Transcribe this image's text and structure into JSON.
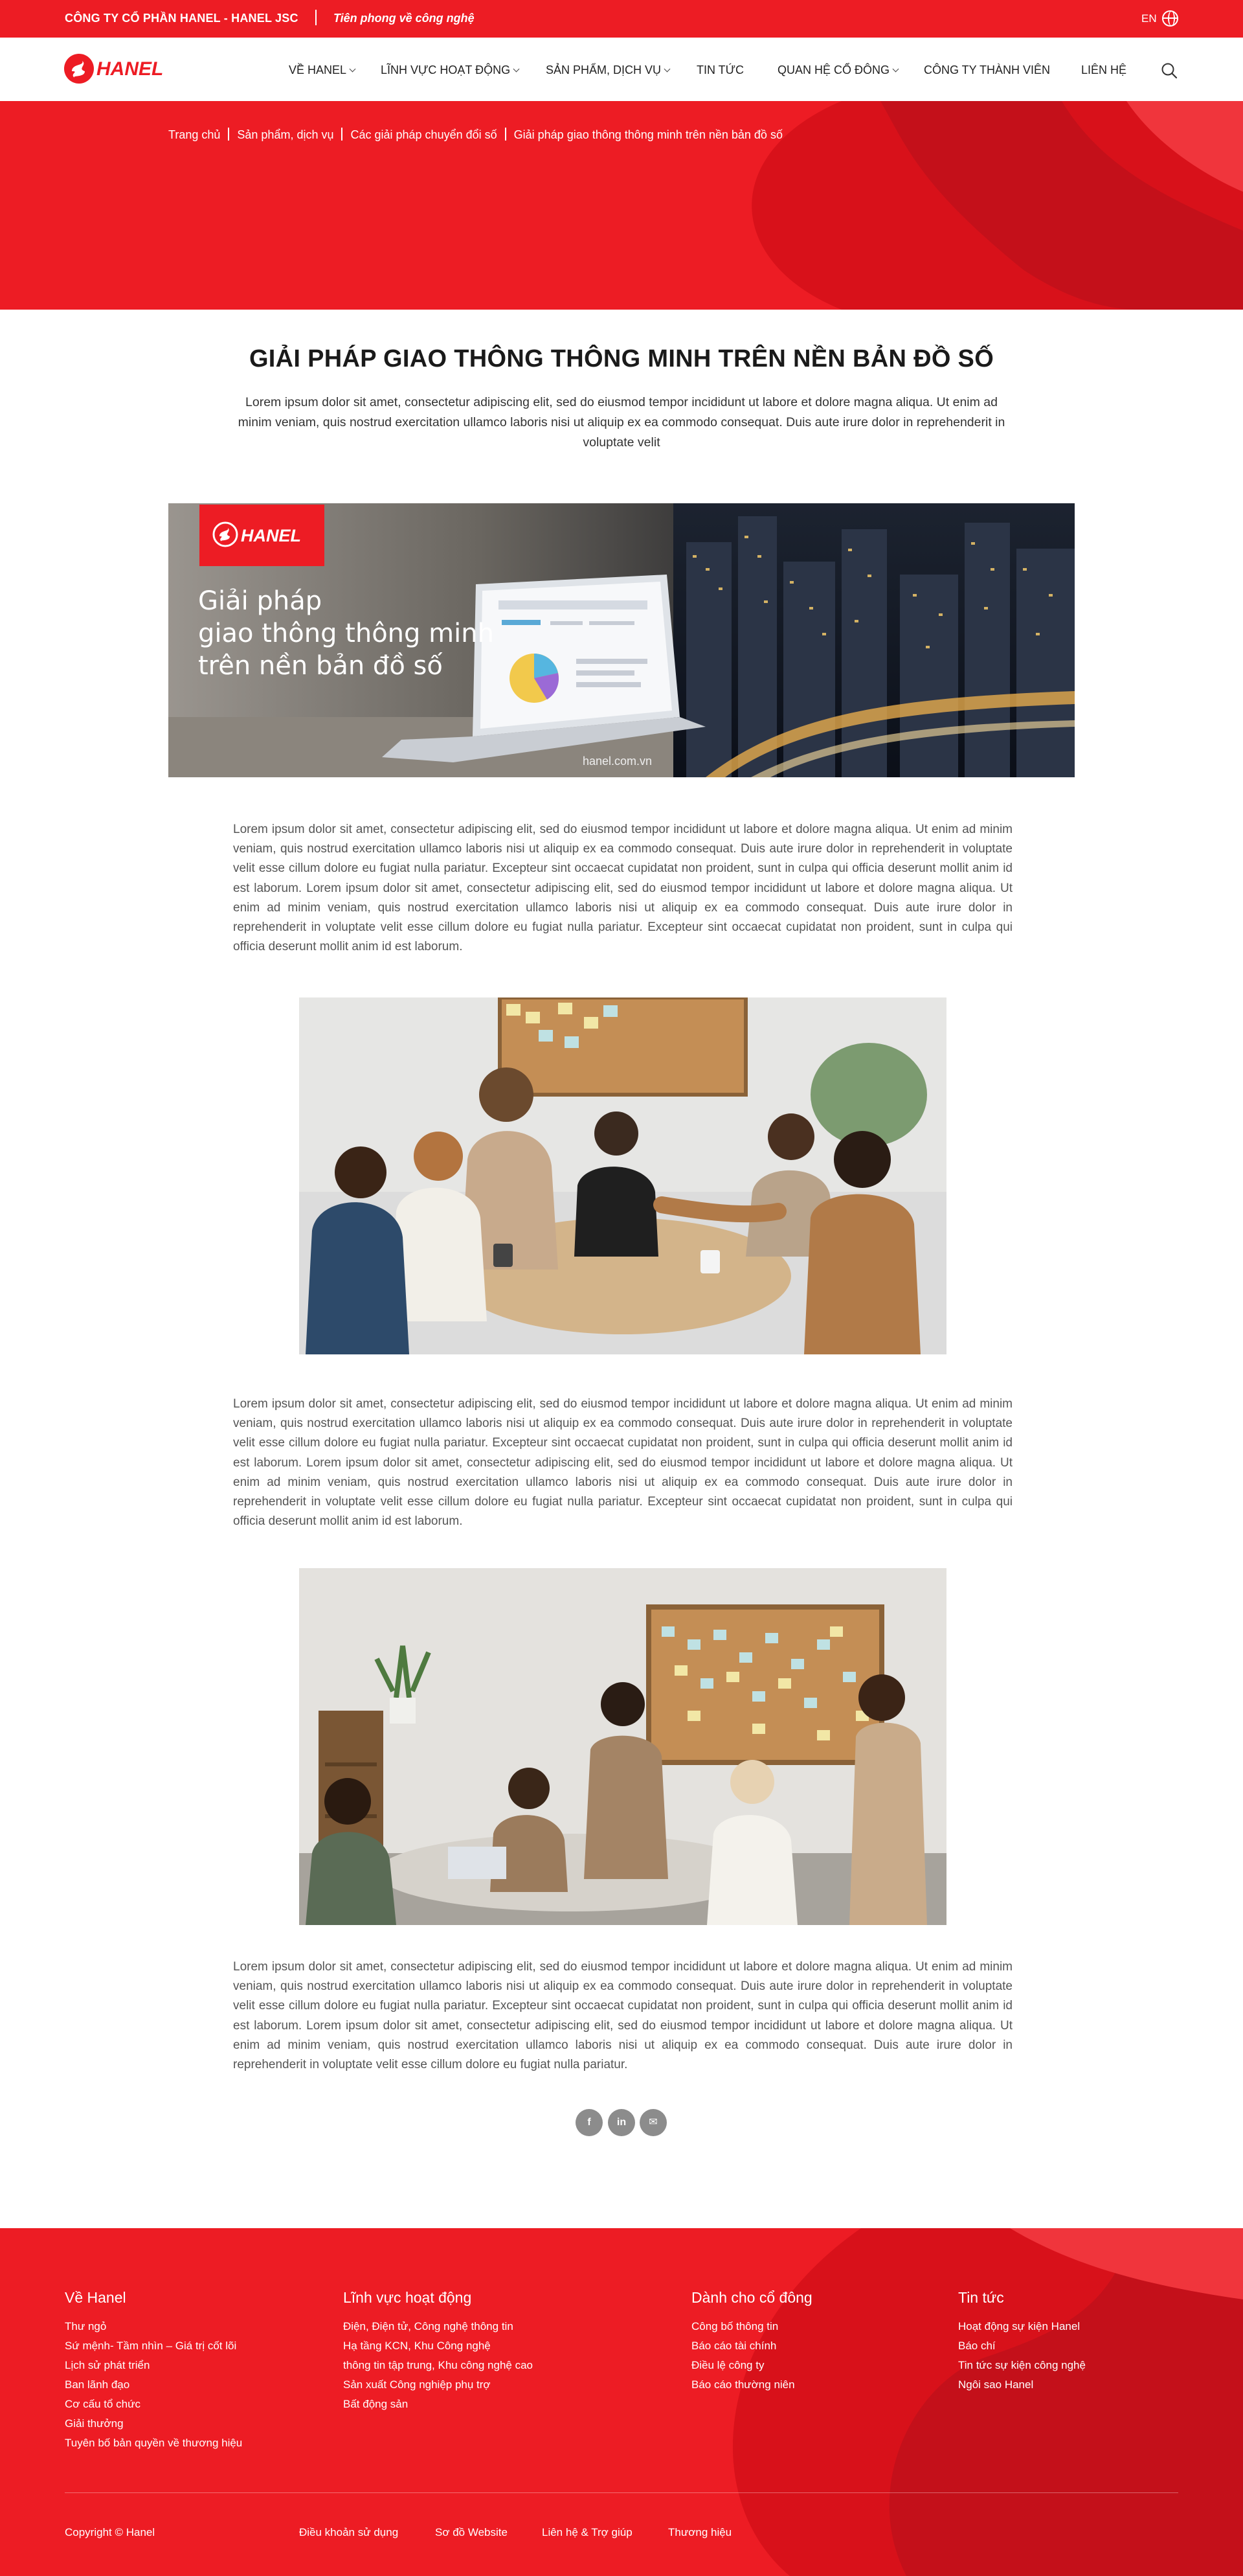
{
  "topbar": {
    "company": "CÔNG TY CỔ PHẦN HANEL - HANEL JSC",
    "slogan": "Tiên phong về công nghệ",
    "lang": "EN"
  },
  "brand": {
    "logo_text": "HANEL",
    "primary_color": "#ed1c24",
    "dark_red": "#d0121a"
  },
  "nav": {
    "items": [
      {
        "label": "VỀ HANEL",
        "has_dropdown": true
      },
      {
        "label": "LĨNH VỰC HOẠT ĐỘNG",
        "has_dropdown": true
      },
      {
        "label": "SẢN PHẨM, DỊCH VỤ",
        "has_dropdown": true
      },
      {
        "label": "TIN TỨC",
        "has_dropdown": false
      },
      {
        "label": "QUAN HỆ CỔ ĐÔNG",
        "has_dropdown": true
      },
      {
        "label": "CÔNG TY THÀNH VIÊN",
        "has_dropdown": false
      },
      {
        "label": "LIÊN HỆ",
        "has_dropdown": false
      }
    ],
    "search_icon": "search-icon"
  },
  "breadcrumb": [
    "Trang chủ",
    "Sản phẩm, dịch vụ",
    "Các giải pháp chuyển đổi số",
    "Giải pháp giao thông thông minh trên nền bản đồ số"
  ],
  "article": {
    "title": "GIẢI PHÁP GIAO THÔNG THÔNG MINH TRÊN NỀN BẢN ĐỒ SỐ",
    "intro": "Lorem ipsum dolor sit amet, consectetur adipiscing elit, sed do eiusmod tempor incididunt ut labore et dolore magna aliqua. Ut enim ad minim veniam, quis nostrud exercitation ullamco laboris nisi ut aliquip ex ea commodo consequat. Duis aute irure dolor in reprehenderit in voluptate velit",
    "banner": {
      "line1": "Giải pháp",
      "line2": "giao thông thông minh",
      "line3": "trên nền bản đồ số",
      "url": "hanel.com.vn"
    },
    "paragraphs": [
      "Lorem ipsum dolor sit amet, consectetur adipiscing elit, sed do eiusmod tempor incididunt ut labore et dolore magna aliqua. Ut enim ad minim veniam, quis nostrud exercitation ullamco laboris nisi ut aliquip ex ea commodo consequat. Duis aute irure dolor in reprehenderit in voluptate velit esse cillum dolore eu fugiat nulla pariatur. Excepteur sint occaecat cupidatat non proident, sunt in culpa qui officia deserunt mollit anim id est laborum. Lorem ipsum dolor sit amet, consectetur adipiscing elit, sed do eiusmod tempor incididunt ut labore et dolore magna aliqua. Ut enim ad minim veniam, quis nostrud exercitation ullamco laboris nisi ut aliquip ex ea commodo consequat. Duis aute irure dolor in reprehenderit in voluptate velit esse cillum dolore eu fugiat nulla pariatur. Excepteur sint occaecat cupidatat non proident, sunt in culpa qui officia deserunt mollit anim id est laborum.",
      "Lorem ipsum dolor sit amet, consectetur adipiscing elit, sed do eiusmod tempor incididunt ut labore et dolore magna aliqua. Ut enim ad minim veniam, quis nostrud exercitation ullamco laboris nisi ut aliquip ex ea commodo consequat. Duis aute irure dolor in reprehenderit in voluptate velit esse cillum dolore eu fugiat nulla pariatur. Excepteur sint occaecat cupidatat non proident, sunt in culpa qui officia deserunt mollit anim id est laborum. Lorem ipsum dolor sit amet, consectetur adipiscing elit, sed do eiusmod tempor incididunt ut labore et dolore magna aliqua. Ut enim ad minim veniam, quis nostrud exercitation ullamco laboris nisi ut aliquip ex ea commodo consequat. Duis aute irure dolor in reprehenderit in voluptate velit esse cillum dolore eu fugiat nulla pariatur. Excepteur sint occaecat cupidatat non proident, sunt in culpa qui officia deserunt mollit anim id est laborum.",
      "Lorem ipsum dolor sit amet, consectetur adipiscing elit, sed do eiusmod tempor incididunt ut labore et dolore magna aliqua. Ut enim ad minim veniam, quis nostrud exercitation ullamco laboris nisi ut aliquip ex ea commodo consequat. Duis aute irure dolor in reprehenderit in voluptate velit esse cillum dolore eu fugiat nulla pariatur. Excepteur sint occaecat cupidatat non proident, sunt in culpa qui officia deserunt mollit anim id est laborum. Lorem ipsum dolor sit amet, consectetur adipiscing elit, sed do eiusmod tempor incididunt ut labore et dolore magna aliqua. Ut enim ad minim veniam, quis nostrud exercitation ullamco laboris nisi ut aliquip ex ea commodo consequat. Duis aute irure dolor in reprehenderit in voluptate velit esse cillum dolore eu fugiat nulla pariatur."
    ],
    "share": [
      {
        "icon": "facebook-icon",
        "glyph": "f"
      },
      {
        "icon": "linkedin-icon",
        "glyph": "in"
      },
      {
        "icon": "email-icon",
        "glyph": "✉"
      }
    ]
  },
  "footer": {
    "columns": [
      {
        "heading": "Về Hanel",
        "links": [
          "Thư ngỏ",
          "Sứ mệnh- Tầm nhìn – Giá trị cốt lõi",
          "Lịch sử phát triển",
          "Ban lãnh đạo",
          "Cơ cấu tổ chức",
          "Giải thưởng",
          "Tuyên bố bản quyền về thương hiệu"
        ]
      },
      {
        "heading": "Lĩnh vực hoạt động",
        "links": [
          "Điện, Điện tử, Công nghệ thông tin",
          "Hạ tầng KCN, Khu Công nghệ",
          "thông tin tập trung, Khu công nghệ cao",
          "Sản xuất Công nghiệp phụ trợ",
          "Bất động sản"
        ]
      },
      {
        "heading": "Dành cho cổ đông",
        "links": [
          "Công bố thông tin",
          "Báo cáo tài chính",
          "Điều lệ công ty",
          "Báo cáo thường niên"
        ]
      },
      {
        "heading": "Tin tức",
        "links": [
          "Hoạt động sự kiện Hanel",
          "Báo chí",
          "Tin tức sự kiện công nghệ",
          "Ngôi sao Hanel"
        ]
      }
    ],
    "copyright": "Copyright © Hanel",
    "bottom_links": [
      "Điều khoản sử dụng",
      "Sơ đồ Website",
      "Liên hệ & Trợ giúp",
      "Thương hiệu"
    ]
  }
}
